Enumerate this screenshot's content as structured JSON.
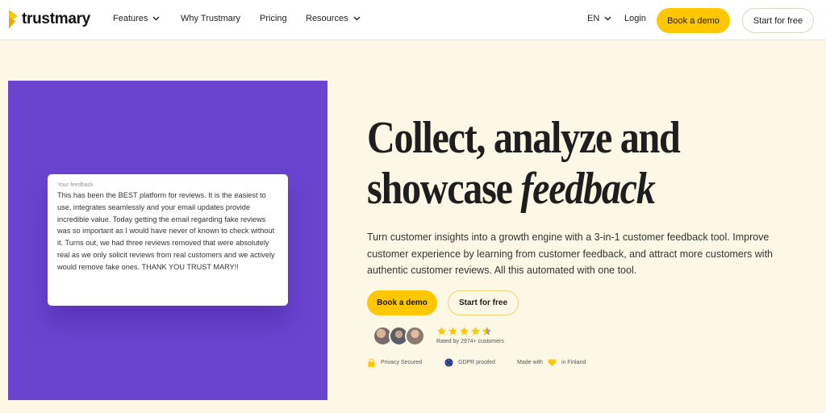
{
  "brand": {
    "name": "trustmary",
    "accent": "#ffc700",
    "purple": "#6a44cf"
  },
  "nav": {
    "items": [
      {
        "label": "Features",
        "dropdown": true
      },
      {
        "label": "Why Trustmary",
        "dropdown": false
      },
      {
        "label": "Pricing",
        "dropdown": false
      },
      {
        "label": "Resources",
        "dropdown": true
      }
    ],
    "language": "EN",
    "login": "Login",
    "book_demo": "Book a demo",
    "start_free": "Start for free"
  },
  "feedback_card": {
    "label": "Your feedback",
    "text": "This has been the BEST platform for reviews. It is the easiest to use, integrates seamlessly and your email updates provide incredible value. Today getting the email regarding fake reviews was so important as I would have never of known to check without it. Turns out, we had three reviews removed that were absolutely real as we only solicit reviews from real customers and we actively would remove fake ones. THANK YOU TRUST MARY!!"
  },
  "hero": {
    "headline_line1": "Collect, analyze and",
    "headline_line2": "showcase",
    "headline_emph": "feedback",
    "subtitle": "Turn customer insights into a growth engine with a 3-in-1 customer feedback tool. Improve customer experience by learning from customer feedback, and attract more customers with authentic customer reviews. All this automated with one tool.",
    "cta_primary": "Book a demo",
    "cta_secondary": "Start for free"
  },
  "rating": {
    "stars": 4.5,
    "rated_text": "Rated by 2974+ customers"
  },
  "trust_badges": {
    "privacy": "Privacy Secured",
    "gdpr": "GDPR proofed",
    "made_with": "Made with",
    "in_finland": "in Finland"
  }
}
